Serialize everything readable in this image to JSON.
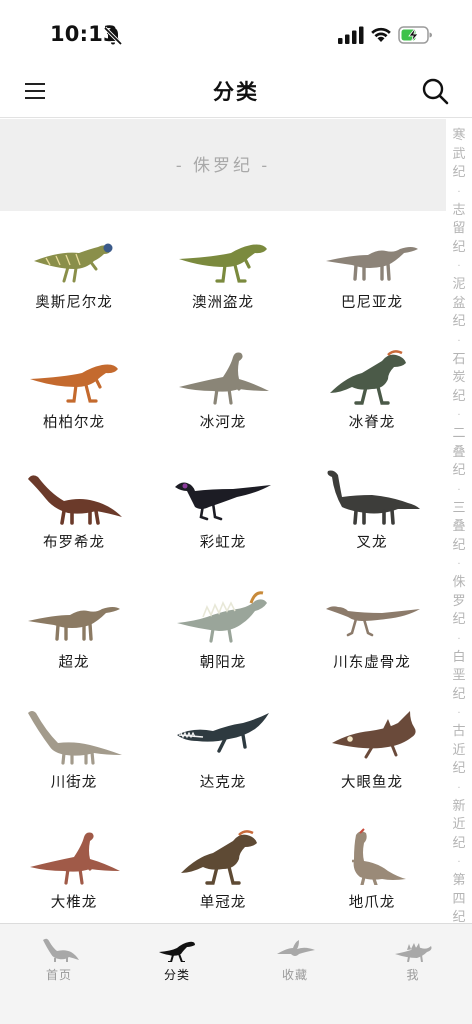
{
  "status_bar": {
    "time": "10:13",
    "icons": [
      "bell-off-icon",
      "cellular-signal-icon",
      "wifi-icon",
      "battery-charging-icon"
    ]
  },
  "header": {
    "title": "分类",
    "left_icon": "menu-icon",
    "right_icon": "search-icon"
  },
  "period_banner": {
    "label": "- 侏罗纪 -"
  },
  "side_index": {
    "periods": [
      "寒武纪",
      "志留纪",
      "泥盆纪",
      "石炭纪",
      "二叠纪",
      "三叠纪",
      "侏罗纪",
      "白垩纪",
      "古近纪",
      "新近纪",
      "第四纪"
    ]
  },
  "dinosaurs": [
    {
      "name": "奥斯尼尔龙",
      "icon": "ornithopod-icon",
      "color": "#8a8f4a"
    },
    {
      "name": "澳洲盗龙",
      "icon": "theropod-icon",
      "color": "#7b8a3e"
    },
    {
      "name": "巴尼亚龙",
      "icon": "sauropod-icon",
      "color": "#8c8378"
    },
    {
      "name": "柏柏尔龙",
      "icon": "theropod-icon",
      "color": "#c46a2e"
    },
    {
      "name": "冰河龙",
      "icon": "prosauropod-icon",
      "color": "#8a8577"
    },
    {
      "name": "冰脊龙",
      "icon": "crested-theropod-icon",
      "color": "#4b5a48"
    },
    {
      "name": "布罗希龙",
      "icon": "brachiosaur-icon",
      "color": "#6b3a2a"
    },
    {
      "name": "彩虹龙",
      "icon": "feathered-dino-icon",
      "color": "#1c1c24"
    },
    {
      "name": "叉龙",
      "icon": "dicraeosaur-icon",
      "color": "#3d3d3a"
    },
    {
      "name": "超龙",
      "icon": "sauropod-icon",
      "color": "#8b7a63"
    },
    {
      "name": "朝阳龙",
      "icon": "frilled-dino-icon",
      "color": "#9aa59a"
    },
    {
      "name": "川东虚骨龙",
      "icon": "small-theropod-icon",
      "color": "#8c7b6b"
    },
    {
      "name": "川街龙",
      "icon": "long-neck-sauropod-icon",
      "color": "#a39b8c"
    },
    {
      "name": "达克龙",
      "icon": "marine-reptile-icon",
      "color": "#2e3a40"
    },
    {
      "name": "大眼鱼龙",
      "icon": "ichthyosaur-icon",
      "color": "#6a4a3a"
    },
    {
      "name": "大椎龙",
      "icon": "prosauropod-icon",
      "color": "#a05a48"
    },
    {
      "name": "单冠龙",
      "icon": "crested-theropod-icon",
      "color": "#5e4a34"
    },
    {
      "name": "地爪龙",
      "icon": "therizinosaur-icon",
      "color": "#9a8a78"
    }
  ],
  "tabs": [
    {
      "label": "首页",
      "icon": "sauropod-tab-icon",
      "active": false
    },
    {
      "label": "分类",
      "icon": "theropod-tab-icon",
      "active": true
    },
    {
      "label": "收藏",
      "icon": "pterosaur-tab-icon",
      "active": false
    },
    {
      "label": "我",
      "icon": "stegosaur-tab-icon",
      "active": false
    }
  ]
}
